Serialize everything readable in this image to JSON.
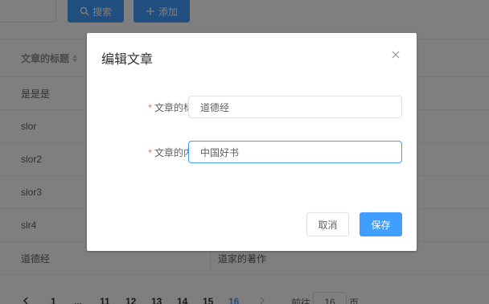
{
  "toolbar": {
    "search_label": "搜索",
    "add_label": "添加"
  },
  "table": {
    "header_title": "文章的标题",
    "rows": [
      {
        "title": "是是是",
        "content": ""
      },
      {
        "title": "slor",
        "content": ""
      },
      {
        "title": "slor2",
        "content": ""
      },
      {
        "title": "slor3",
        "content": ""
      },
      {
        "title": "slr4",
        "content": ""
      },
      {
        "title": "道德经",
        "content": "道家的著作"
      }
    ]
  },
  "pagination": {
    "pages": [
      "1",
      "...",
      "11",
      "12",
      "13",
      "14",
      "15",
      "16"
    ],
    "current_page": "16",
    "goto_label": "前往",
    "goto_value": "16",
    "page_suffix": "页"
  },
  "dialog": {
    "title": "编辑文章",
    "fields": [
      {
        "label": "文章的标题",
        "value": "道德经",
        "required_mark": "*"
      },
      {
        "label": "文章的内容",
        "value": "中国好书",
        "required_mark": "*"
      }
    ],
    "cancel_label": "取消",
    "save_label": "保存"
  },
  "colors": {
    "primary": "#409eff",
    "required": "#f56c6c",
    "mask": "rgba(0,0,0,0.5)"
  }
}
